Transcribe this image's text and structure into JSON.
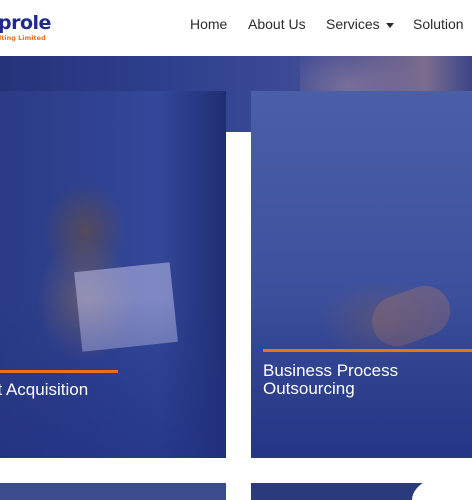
{
  "brand": {
    "name": "prole",
    "tagline": "lting Limited",
    "colors": {
      "primary": "#1f2a8c",
      "accent": "#e9731a"
    }
  },
  "nav": {
    "items": [
      {
        "label": "Home"
      },
      {
        "label": "About Us"
      },
      {
        "label": "Services",
        "has_dropdown": true
      },
      {
        "label": "Solution"
      }
    ]
  },
  "cards": [
    {
      "title": "nt Acquisition"
    },
    {
      "title_line1": "Business Process",
      "title_line2": "Outsourcing"
    }
  ]
}
